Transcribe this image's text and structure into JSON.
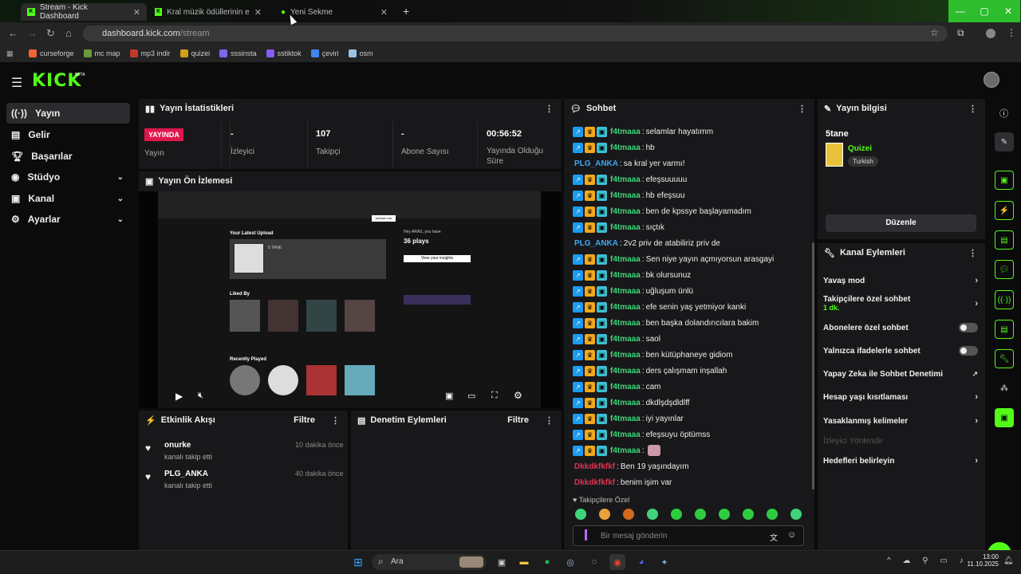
{
  "browser": {
    "tabs": [
      {
        "label": "Stream - Kick Dashboard"
      },
      {
        "label": "Kral müzik ödüllerinin en iyi yıld"
      },
      {
        "label": "Yeni Sekme"
      }
    ],
    "url_host": "dashboard.kick.com",
    "url_path": "/stream",
    "bookmarks": [
      {
        "label": "curseforge",
        "color": "#f16436"
      },
      {
        "label": "mc map",
        "color": "#6a9a3b"
      },
      {
        "label": "mp3 indir",
        "color": "#c0392b"
      },
      {
        "label": "quizei",
        "color": "#d4a017"
      },
      {
        "label": "sssinsta",
        "color": "#7b68ee"
      },
      {
        "label": "sstiktok",
        "color": "#8a5cf6"
      },
      {
        "label": "çeviri",
        "color": "#4285f4"
      },
      {
        "label": "osm",
        "color": "#9bc3e6"
      }
    ]
  },
  "kick": {
    "logo": "KICK",
    "beta": "BETA"
  },
  "sidebar": {
    "items": [
      {
        "label": "Yayın",
        "icon": "broadcast-icon"
      },
      {
        "label": "Gelir",
        "icon": "revenue-icon"
      },
      {
        "label": "Başarılar",
        "icon": "trophy-icon"
      },
      {
        "label": "Stüdyo",
        "icon": "studio-icon"
      },
      {
        "label": "Kanal",
        "icon": "channel-icon"
      },
      {
        "label": "Ayarlar",
        "icon": "settings-icon"
      }
    ]
  },
  "stats": {
    "title": "Yayın İstatistikleri",
    "live_badge": "YAYINDA",
    "live_label": "Yayın",
    "items": [
      {
        "value": "-",
        "label": "İzleyici"
      },
      {
        "value": "107",
        "label": "Takipçi"
      },
      {
        "value": "-",
        "label": "Abone Sayısı"
      },
      {
        "value": "00:56:52",
        "label": "Yayında Olduğu Süre"
      }
    ]
  },
  "preview": {
    "title": "Yayın Ön İzlemesi",
    "card_title": "Your Latest Upload",
    "card_name": "5 TANE",
    "side_title": "Hey ARAS, you have",
    "side_plays": "36 plays",
    "liked": "Liked By",
    "recent": "Recently Played",
    "insights": "View your insights",
    "upload": "Upload now"
  },
  "events": {
    "title": "Etkinlik Akışı",
    "filter": "Filtre",
    "items": [
      {
        "name": "onurke",
        "sub": "kanalı takip etti",
        "time": "10 dakika önce"
      },
      {
        "name": "PLG_ANKA",
        "sub": "kanalı takip etti",
        "time": "40 dakika önce"
      }
    ]
  },
  "moderation": {
    "title": "Denetim Eylemleri",
    "filter": "Filtre"
  },
  "chat": {
    "title": "Sohbet",
    "messages": [
      {
        "user": "f4tmaaa",
        "text": "selamlar hayatımm",
        "badges": true,
        "color": "#3fd47a"
      },
      {
        "user": "f4tmaaa",
        "text": "hb",
        "badges": true,
        "color": "#3fd47a"
      },
      {
        "user": "PLG_ANKA",
        "text": "sa kral yer varmı!",
        "badges": false,
        "color": "#3fa7f0"
      },
      {
        "user": "f4tmaaa",
        "text": "efeşsuuuuu",
        "badges": true,
        "color": "#3fd47a"
      },
      {
        "user": "f4tmaaa",
        "text": "hb efeşsuu",
        "badges": true,
        "color": "#3fd47a"
      },
      {
        "user": "f4tmaaa",
        "text": "ben de kpssye başlayamadım",
        "badges": true,
        "color": "#3fd47a"
      },
      {
        "user": "f4tmaaa",
        "text": "sıçtık",
        "badges": true,
        "color": "#3fd47a"
      },
      {
        "user": "PLG_ANKA",
        "text": "2v2 priv de atabiliriz priv de",
        "badges": false,
        "color": "#3fa7f0"
      },
      {
        "user": "f4tmaaa",
        "text": "Sen niye yayın açmıyorsun arasgayi",
        "badges": true,
        "color": "#3fd47a"
      },
      {
        "user": "f4tmaaa",
        "text": "bk olursunuz",
        "badges": true,
        "color": "#3fd47a"
      },
      {
        "user": "f4tmaaa",
        "text": "uğluşum ünlü",
        "badges": true,
        "color": "#3fd47a"
      },
      {
        "user": "f4tmaaa",
        "text": "efe senin yaş yetmiyor kanki",
        "badges": true,
        "color": "#3fd47a"
      },
      {
        "user": "f4tmaaa",
        "text": "ben başka dolandırıcılara bakim",
        "badges": true,
        "color": "#3fd47a"
      },
      {
        "user": "f4tmaaa",
        "text": "saol",
        "badges": true,
        "color": "#3fd47a"
      },
      {
        "user": "f4tmaaa",
        "text": "ben kütüphaneye gidiom",
        "badges": true,
        "color": "#3fd47a"
      },
      {
        "user": "f4tmaaa",
        "text": "ders çalışmam inşallah",
        "badges": true,
        "color": "#3fd47a"
      },
      {
        "user": "f4tmaaa",
        "text": "cam",
        "badges": true,
        "color": "#3fd47a"
      },
      {
        "user": "f4tmaaa",
        "text": "dkdlşdşdldlff",
        "badges": true,
        "color": "#3fd47a"
      },
      {
        "user": "f4tmaaa",
        "text": "iyi yayınlar",
        "badges": true,
        "color": "#3fd47a"
      },
      {
        "user": "f4tmaaa",
        "text": "efeşsuyu öptümss",
        "badges": true,
        "color": "#3fd47a"
      },
      {
        "user": "f4tmaaa",
        "text": "",
        "badges": true,
        "color": "#3fd47a"
      },
      {
        "user": "Dkkdkfkfkf",
        "text": "Ben 19 yaşındayım",
        "badges": false,
        "color": "#e0334f"
      },
      {
        "user": "Dkkdkfkfkf",
        "text": "benim işim var",
        "badges": false,
        "color": "#e0334f"
      }
    ],
    "mode_label": "Takipçilere Özel",
    "input_placeholder": "Bir mesaj gönderin"
  },
  "info": {
    "title": "Yayın bilgisi",
    "stream_title": "5tane",
    "category": "Quizei",
    "tag": "Turkish",
    "edit": "Düzenle"
  },
  "actions": {
    "title": "Kanal Eylemleri",
    "items": [
      {
        "label": "Yavaş mod",
        "control": "chevron"
      },
      {
        "label": "Takipçilere özel sohbet",
        "sub": "1 dk.",
        "control": "chevron"
      },
      {
        "label": "Abonelere özel sohbet",
        "control": "toggle"
      },
      {
        "label": "Yalnızca ifadelerle sohbet",
        "control": "toggle"
      },
      {
        "label": "Yapay Zeka ile Sohbet Denetimi",
        "control": "external"
      },
      {
        "label": "Hesap yaşı kısıtlaması",
        "control": "chevron"
      },
      {
        "label": "Yasaklanmış kelimeler",
        "control": "chevron"
      },
      {
        "label": "İzleyici Yönlendir",
        "control": "none",
        "disabled": true
      },
      {
        "label": "Hedefleri belirleyin",
        "control": "chevron"
      }
    ]
  },
  "taskbar": {
    "search": "Ara",
    "time": "13:00",
    "date": "11.10.2025"
  },
  "colors": {
    "kick_green": "#53fc18",
    "live_red": "#e0164d"
  }
}
